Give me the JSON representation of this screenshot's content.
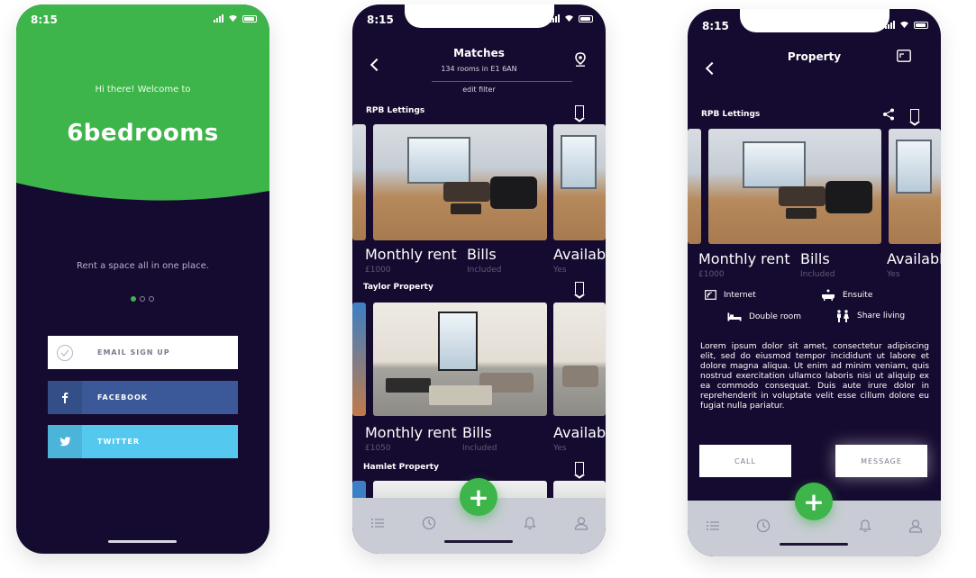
{
  "status_time": "8:15",
  "welcome": {
    "greeting": "Hi there! Welcome to",
    "brand": "6bedrooms",
    "tagline": "Rent a space all in one place.",
    "email_btn": "EMAIL SIGN UP",
    "facebook_btn": "FACEBOOK",
    "twitter_btn": "TWITTER",
    "brand_color": "#3db54a"
  },
  "matches": {
    "title": "Matches",
    "subtitle": "134 rooms in E1 6AN",
    "edit_filter": "edit filter",
    "listings": [
      {
        "agent": "RPB Lettings",
        "rent_label": "Monthly rent",
        "rent": "£1000",
        "bills_label": "Bills",
        "bills": "Included",
        "avail_label": "Available",
        "avail": "Yes"
      },
      {
        "agent": "Taylor Property",
        "rent_label": "Monthly rent",
        "rent": "£1050",
        "bills_label": "Bills",
        "bills": "Included",
        "avail_label": "Available",
        "avail": "Yes"
      },
      {
        "agent": "Hamlet Property"
      }
    ]
  },
  "property": {
    "title": "Property",
    "agent": "RPB Lettings",
    "rent_label": "Monthly rent",
    "rent": "£1000",
    "bills_label": "Bills",
    "bills": "Included",
    "avail_label": "Available",
    "avail": "Yes",
    "amenities": [
      "Internet",
      "Ensuite",
      "Double room",
      "Share living"
    ],
    "description": "Lorem ipsum dolor sit amet, consectetur adipiscing elit, sed do eiusmod tempor incididunt ut labore et dolore magna aliqua. Ut enim ad minim veniam, quis nostrud exercitation ullamco laboris nisi ut aliquip ex ea commodo consequat. Duis aute irure dolor in reprehenderit in voluptate velit esse cillum dolore eu fugiat nulla pariatur.",
    "call_btn": "CALL",
    "message_btn": "MESSAGE"
  },
  "fab_label": "+",
  "icons": [
    "list-icon",
    "clock-icon",
    "bell-icon",
    "user-icon",
    "bookmark-icon",
    "share-icon",
    "map-pin-icon",
    "expand-icon",
    "back-icon"
  ]
}
